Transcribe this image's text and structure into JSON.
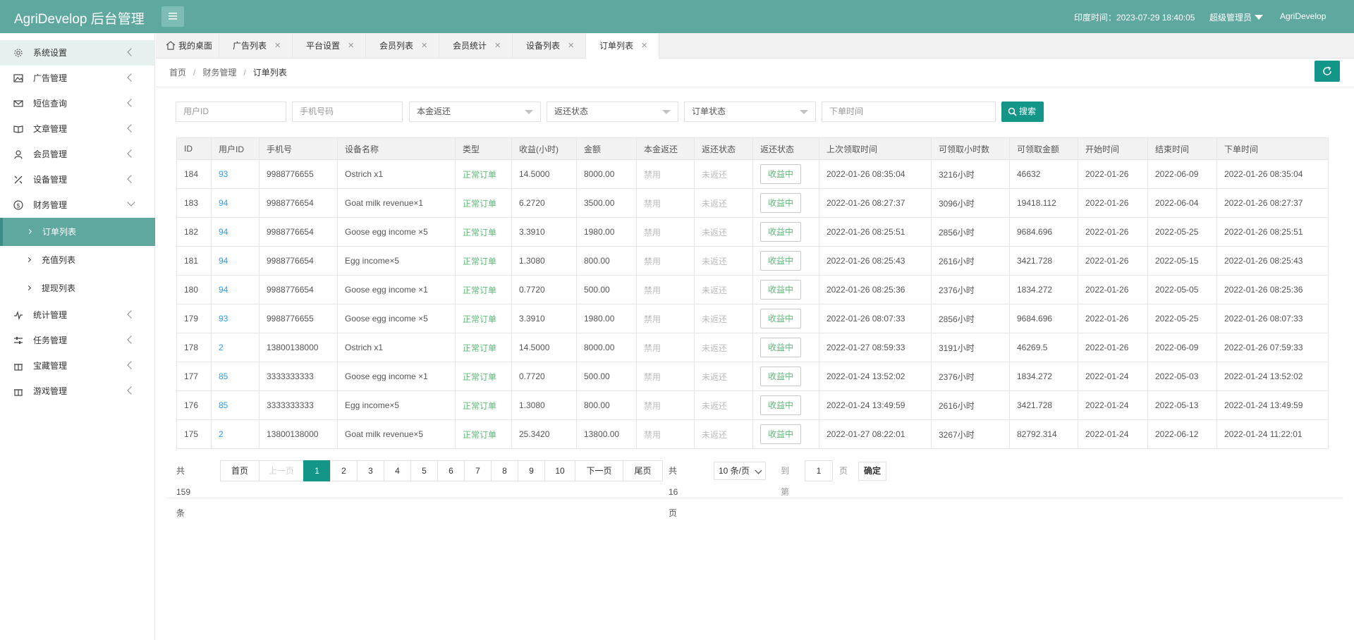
{
  "header": {
    "logo": "AgriDevelop 后台管理",
    "time": "印度时间：2023-07-29 18:40:05",
    "admin": "超级管理员",
    "brand": "AgriDevelop"
  },
  "sidebar": {
    "items": [
      {
        "label": "系统设置"
      },
      {
        "label": "广告管理"
      },
      {
        "label": "短信查询"
      },
      {
        "label": "文章管理"
      },
      {
        "label": "会员管理"
      },
      {
        "label": "设备管理"
      },
      {
        "label": "财务管理"
      }
    ],
    "subitems": [
      {
        "label": "订单列表"
      },
      {
        "label": "充值列表"
      },
      {
        "label": "提现列表"
      }
    ],
    "items2": [
      {
        "label": "统计管理"
      },
      {
        "label": "任务管理"
      },
      {
        "label": "宝藏管理"
      },
      {
        "label": "游戏管理"
      }
    ]
  },
  "tabs": [
    {
      "label": "我的桌面"
    },
    {
      "label": "广告列表"
    },
    {
      "label": "平台设置"
    },
    {
      "label": "会员列表"
    },
    {
      "label": "会员统计"
    },
    {
      "label": "设备列表"
    },
    {
      "label": "订单列表"
    }
  ],
  "breadcrumb": [
    "首页",
    "财务管理",
    "订单列表"
  ],
  "search": {
    "user_id_placeholder": "用户ID",
    "phone_placeholder": "手机号码",
    "principal_return": "本金返还",
    "return_status": "返还状态",
    "order_status": "订单状态",
    "order_time_placeholder": "下单时间",
    "search_label": "搜索"
  },
  "table": {
    "headers": [
      "ID",
      "用户ID",
      "手机号",
      "设备名称",
      "类型",
      "收益(小时)",
      "金额",
      "本金返还",
      "返还状态",
      "返还状态",
      "上次领取时间",
      "可领取小时数",
      "可领取金额",
      "开始时间",
      "结束时间",
      "下单时间"
    ],
    "rows": [
      [
        "184",
        "93",
        "9988776655",
        "Ostrich x1",
        "正常订单",
        "14.5000",
        "8000.00",
        "禁用",
        "未返还",
        "收益中",
        "2022-01-26 08:35:04",
        "3216小时",
        "46632",
        "2022-01-26",
        "2022-06-09",
        "2022-01-26 08:35:04"
      ],
      [
        "183",
        "94",
        "9988776654",
        "Goat milk revenue×1",
        "正常订单",
        "6.2720",
        "3500.00",
        "禁用",
        "未返还",
        "收益中",
        "2022-01-26 08:27:37",
        "3096小时",
        "19418.112",
        "2022-01-26",
        "2022-06-04",
        "2022-01-26 08:27:37"
      ],
      [
        "182",
        "94",
        "9988776654",
        "Goose egg income ×5",
        "正常订单",
        "3.3910",
        "1980.00",
        "禁用",
        "未返还",
        "收益中",
        "2022-01-26 08:25:51",
        "2856小时",
        "9684.696",
        "2022-01-26",
        "2022-05-25",
        "2022-01-26 08:25:51"
      ],
      [
        "181",
        "94",
        "9988776654",
        "Egg income×5",
        "正常订单",
        "1.3080",
        "800.00",
        "禁用",
        "未返还",
        "收益中",
        "2022-01-26 08:25:43",
        "2616小时",
        "3421.728",
        "2022-01-26",
        "2022-05-15",
        "2022-01-26 08:25:43"
      ],
      [
        "180",
        "94",
        "9988776654",
        "Goose egg income ×1",
        "正常订单",
        "0.7720",
        "500.00",
        "禁用",
        "未返还",
        "收益中",
        "2022-01-26 08:25:36",
        "2376小时",
        "1834.272",
        "2022-01-26",
        "2022-05-05",
        "2022-01-26 08:25:36"
      ],
      [
        "179",
        "93",
        "9988776655",
        "Goose egg income ×5",
        "正常订单",
        "3.3910",
        "1980.00",
        "禁用",
        "未返还",
        "收益中",
        "2022-01-26 08:07:33",
        "2856小时",
        "9684.696",
        "2022-01-26",
        "2022-05-25",
        "2022-01-26 08:07:33"
      ],
      [
        "178",
        "2",
        "13800138000",
        "Ostrich x1",
        "正常订单",
        "14.5000",
        "8000.00",
        "禁用",
        "未返还",
        "收益中",
        "2022-01-27 08:59:33",
        "3191小时",
        "46269.5",
        "2022-01-26",
        "2022-06-09",
        "2022-01-26 07:59:33"
      ],
      [
        "177",
        "85",
        "3333333333",
        "Goose egg income ×1",
        "正常订单",
        "0.7720",
        "500.00",
        "禁用",
        "未返还",
        "收益中",
        "2022-01-24 13:52:02",
        "2376小时",
        "1834.272",
        "2022-01-24",
        "2022-05-03",
        "2022-01-24 13:52:02"
      ],
      [
        "176",
        "85",
        "3333333333",
        "Egg income×5",
        "正常订单",
        "1.3080",
        "800.00",
        "禁用",
        "未返还",
        "收益中",
        "2022-01-24 13:49:59",
        "2616小时",
        "3421.728",
        "2022-01-24",
        "2022-05-13",
        "2022-01-24 13:49:59"
      ],
      [
        "175",
        "2",
        "13800138000",
        "Goat milk revenue×5",
        "正常订单",
        "25.3420",
        "13800.00",
        "禁用",
        "未返还",
        "收益中",
        "2022-01-27 08:22:01",
        "3267小时",
        "82792.314",
        "2022-01-24",
        "2022-06-12",
        "2022-01-24 11:22:01"
      ]
    ]
  },
  "pagination": {
    "total": "共 159 条",
    "first": "首页",
    "prev": "上一页",
    "pages": [
      "1",
      "2",
      "3",
      "4",
      "5",
      "6",
      "7",
      "8",
      "9",
      "10"
    ],
    "next": "下一页",
    "last": "尾页",
    "page_count": "共 16 页",
    "per_page": "10 条/页",
    "goto": "到第",
    "goto_value": "1",
    "page_unit": "页",
    "confirm": "确定"
  },
  "colors": {
    "header": "#5fa8a0",
    "accent": "#139688",
    "link": "#1e9fff",
    "success": "#5fb878"
  }
}
